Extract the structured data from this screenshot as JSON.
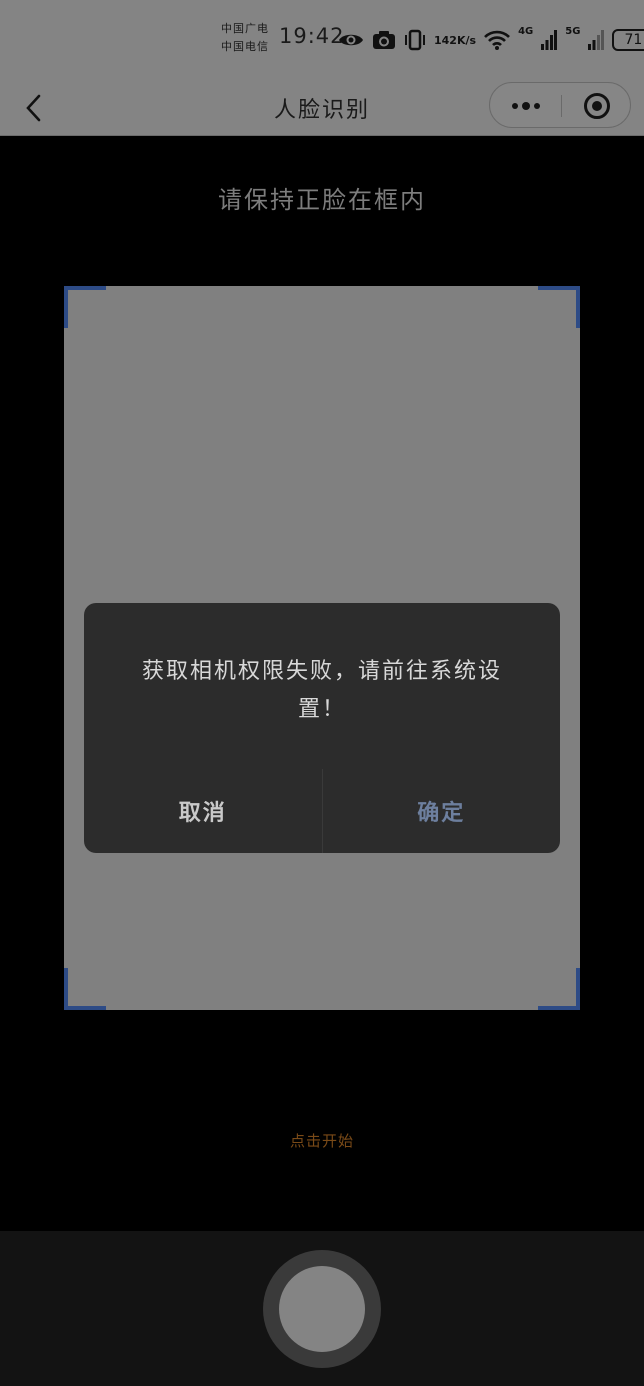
{
  "status_bar": {
    "carrier_1": "中国广电",
    "carrier_2": "中国电信",
    "time": "19:42",
    "net_speed_value": "142",
    "net_speed_unit": "K/s",
    "net_4g": "4G",
    "net_5g": "5G",
    "battery": "71",
    "icons": [
      "eye-icon",
      "camera-icon",
      "vibrate-icon",
      "wifi-icon",
      "signal-icon"
    ]
  },
  "nav": {
    "title": "人脸识别",
    "icons": [
      "back-chevron-icon",
      "more-dots-icon",
      "close-miniprogram-icon"
    ]
  },
  "page": {
    "hint": "请保持正脸在框内",
    "start_label": "点击开始"
  },
  "dialog": {
    "message": "获取相机权限失败，请前往系统设置！",
    "cancel_label": "取消",
    "confirm_label": "确定"
  },
  "colors": {
    "frame_corner": "#2d4b86",
    "confirm_text": "#6d7f9e",
    "start_label": "#7a4a17"
  }
}
